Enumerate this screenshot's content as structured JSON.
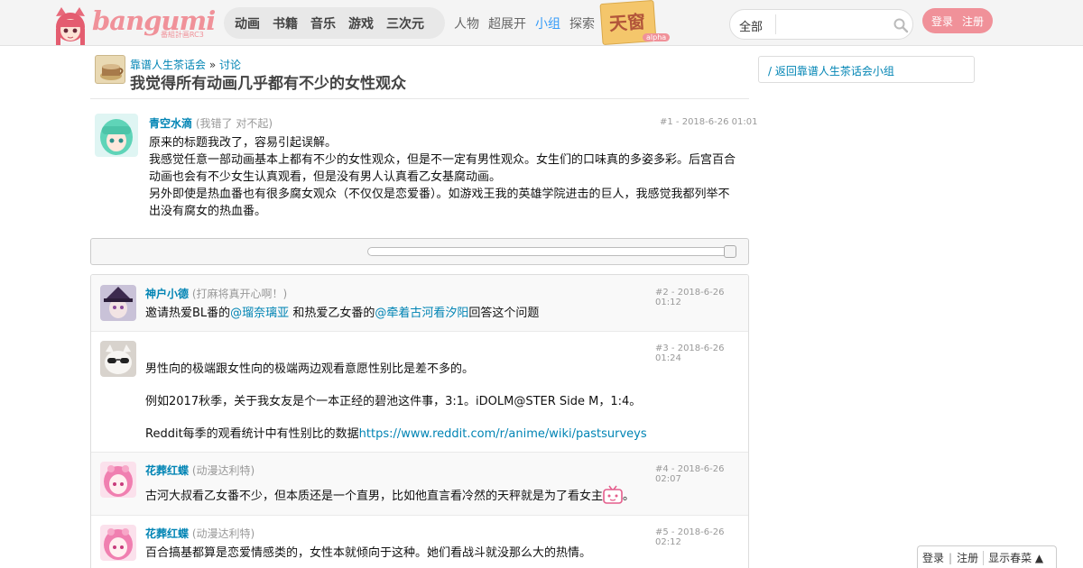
{
  "header": {
    "logo_text": "bangumi",
    "logo_sub": "番組計画RC3",
    "main_nav": [
      "动画",
      "书籍",
      "音乐",
      "游戏",
      "三次元"
    ],
    "sub_nav": [
      "人物",
      "超展开",
      "小组",
      "探索"
    ],
    "active_sub_nav": "小组",
    "tianchuang": "天窗",
    "alpha": "alpha",
    "search": {
      "category": "全部",
      "placeholder": ""
    },
    "login": "登录",
    "register": "注册",
    "accent_color": "#f09199",
    "link_color": "#0084b4"
  },
  "topic": {
    "group_name": "靠谱人生茶话会",
    "crumb_sep": "»",
    "crumb_section": "讨论",
    "title": "我觉得所有动画几乎都有不少的女性观众"
  },
  "sidebar": {
    "back_link": "/ 返回靠谱人生茶话会小组"
  },
  "first_post": {
    "user": "青空水滴",
    "sign": "(我错了 对不起)",
    "floor": "#1 - 2018-6-26 01:01",
    "lines": [
      "原来的标题我改了，容易引起误解。",
      "我感觉任意一部动画基本上都有不少的女性观众，但是不一定有男性观众。女生们的口味真的多姿多彩。后宫百合",
      "动画也会有不少女生认真观看，但是没有男人认真看乙女基腐动画。",
      "另外即使是热血番也有很多腐女观众（不仅仅是恋爱番）。如游戏王我的英雄学院进击的巨人，我感觉我都列举不",
      "出没有腐女的热血番。"
    ]
  },
  "comments": [
    {
      "user": "神户小德",
      "sign": "(打麻将真开心啊！)",
      "floor": "#2 - 2018-6-26 01:12",
      "text_a": "邀请热爱BL番的",
      "mention_1": "@瑠奈璃亚",
      "text_b": " 和热爱乙女番的",
      "mention_2": "@牵着古河看汐阳",
      "text_c": "回答这个问题"
    },
    {
      "user": "",
      "sign": "",
      "floor": "#3 - 2018-6-26 01:24",
      "p1": "男性向的极端跟女性向的极端两边观看意愿性别比是差不多的。",
      "p2": "例如2017秋季，关于我女友是个一本正经的碧池这件事，3:1。iDOLM@STER Side M，1:4。",
      "p3_text": "Reddit每季的观看统计中有性别比的数据",
      "p3_link": "https://www.reddit.com/r/anime/wiki/pastsurveys"
    },
    {
      "user": "花葬红蝶",
      "sign": "(动漫达利特)",
      "floor": "#4 - 2018-6-26 02:07",
      "text": "古河大叔看乙女番不少，但本质还是一个直男，比如他直言看冷然的天秤就是为了看女主",
      "text_end": "。"
    },
    {
      "user": "花葬红蝶",
      "sign": "(动漫达利特)",
      "floor": "#5 - 2018-6-26 02:12",
      "text": "百合搞基都算是恋爱情感类的，女性本就倾向于这种。她们看战斗就没那么大的热情。"
    }
  ],
  "float_bar": {
    "login": "登录",
    "sep": "|",
    "register": "注册",
    "toggle": "显示春菜 ▲"
  }
}
